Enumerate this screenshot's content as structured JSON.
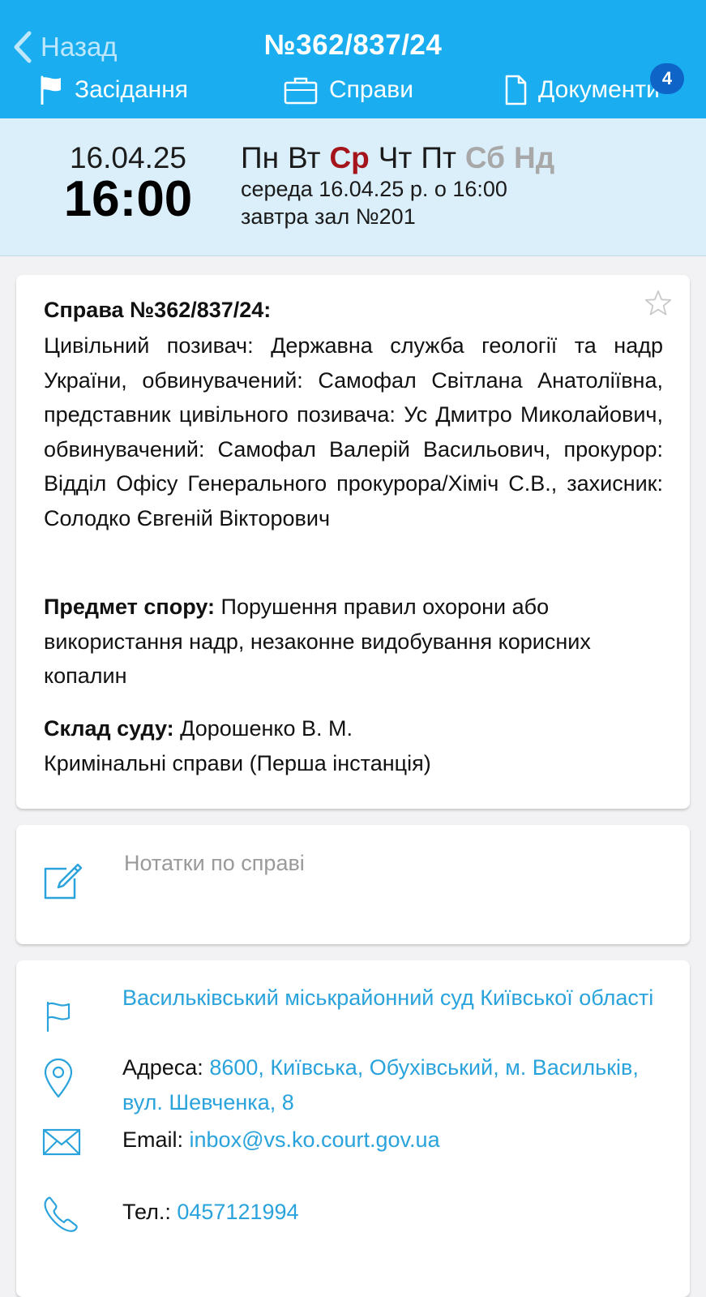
{
  "header": {
    "back_label": "Назад",
    "title": "№362/837/24",
    "tabs": [
      {
        "label": "Засідання",
        "icon": "flag-icon"
      },
      {
        "label": "Справи",
        "icon": "briefcase-icon"
      },
      {
        "label": "Документи",
        "icon": "document-icon"
      }
    ],
    "documents_badge": "4",
    "background_color": "#1aaef0"
  },
  "schedule": {
    "date": "16.04.25",
    "time": "16:00",
    "weekdays": [
      {
        "label": "Пн",
        "state": "normal"
      },
      {
        "label": "Вт",
        "state": "normal"
      },
      {
        "label": "Ср",
        "state": "active"
      },
      {
        "label": "Чт",
        "state": "normal"
      },
      {
        "label": "Пт",
        "state": "normal"
      },
      {
        "label": "Сб",
        "state": "weekend"
      },
      {
        "label": "Нд",
        "state": "weekend"
      }
    ],
    "line1": "середа 16.04.25 р. о 16:00",
    "line2": "завтра зал №201",
    "active_color": "#a5141a"
  },
  "case": {
    "title": "Справа №362/837/24:",
    "parties": "Цивільний позивач: Державна служба геології та надр України, обвинувачений: Самофал Світлана Анатоліївна, представник цивільного позивача: Ус Дмитро Миколайович, обвинувачений: Самофал Валерій Васильович, прокурор: Відділ Офісу Генерального прокурора/Хіміч С.В., захисник: Солодко Євгеній Вікторович",
    "subject_label": "Предмет спору:",
    "subject_value": "Порушення правил охорони або використання надр, незаконне видобування корисних копалин",
    "court_label": "Склад суду:",
    "court_value": "Дорошенко В. М.",
    "category": "Кримінальні справи (Перша інстанція)"
  },
  "notes": {
    "placeholder": "Нотатки по справі"
  },
  "court_info": {
    "name": "Васильківський міськрайонний суд Київської області",
    "address_label": "Адреса:",
    "address_value": "8600, Київська, Обухівський, м. Васильків, вул. Шевченка, 8",
    "email_label": "Email:",
    "email_value": "inbox@vs.ko.court.gov.ua",
    "phone_label": "Тел.:",
    "phone_value": "0457121994",
    "link_color": "#2aa3dc"
  }
}
